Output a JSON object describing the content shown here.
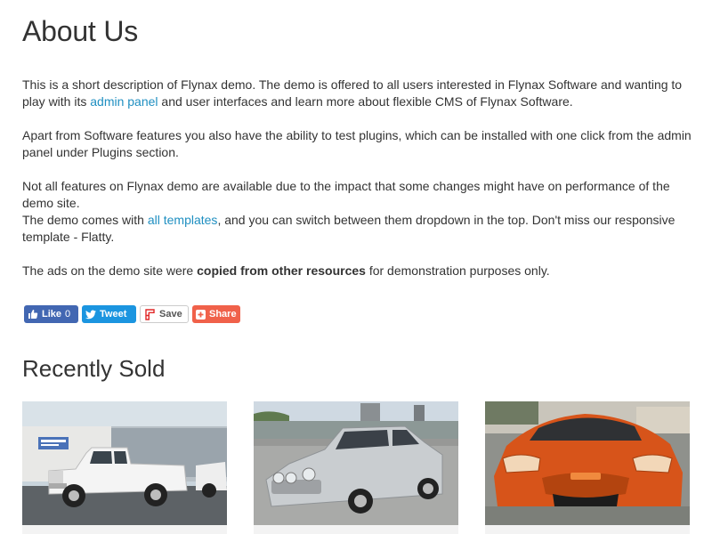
{
  "page_title": "About Us",
  "paragraphs": {
    "p1": {
      "before_link": "This is a short description of Flynax demo. The demo is offered to all users interested in Flynax Software and wanting to play with its ",
      "link": "admin panel",
      "after_link": " and user interfaces and learn more about flexible CMS of Flynax Software."
    },
    "p2": "Apart from Software features you also have the ability to test plugins, which can be installed with one click from the admin panel under Plugins section.",
    "p3": "Not all features on Flynax demo are available due to the impact that some changes might have on performance of the demo site.",
    "p4": {
      "before_link": "The demo comes with ",
      "link": "all templates",
      "after_link": ", and you can switch between them dropdown in the top. Don't miss our responsive template - Flatty."
    },
    "p5": {
      "before_bold": "The ads on the demo site were ",
      "bold": "copied from other resources",
      "after_bold": " for demonstration purposes only."
    }
  },
  "share": {
    "like_label": "Like",
    "like_count": "0",
    "tweet_label": "Tweet",
    "save_label": "Save",
    "share_label": "Share"
  },
  "recently_sold": {
    "title": "Recently Sold",
    "cards": [
      {
        "image": "white pickup truck"
      },
      {
        "image": "silver sedan"
      },
      {
        "image": "orange sports car"
      }
    ]
  },
  "colors": {
    "link": "#1f8fc1",
    "facebook": "#4267b2",
    "twitter": "#1b95e0",
    "share": "#f0614a"
  }
}
